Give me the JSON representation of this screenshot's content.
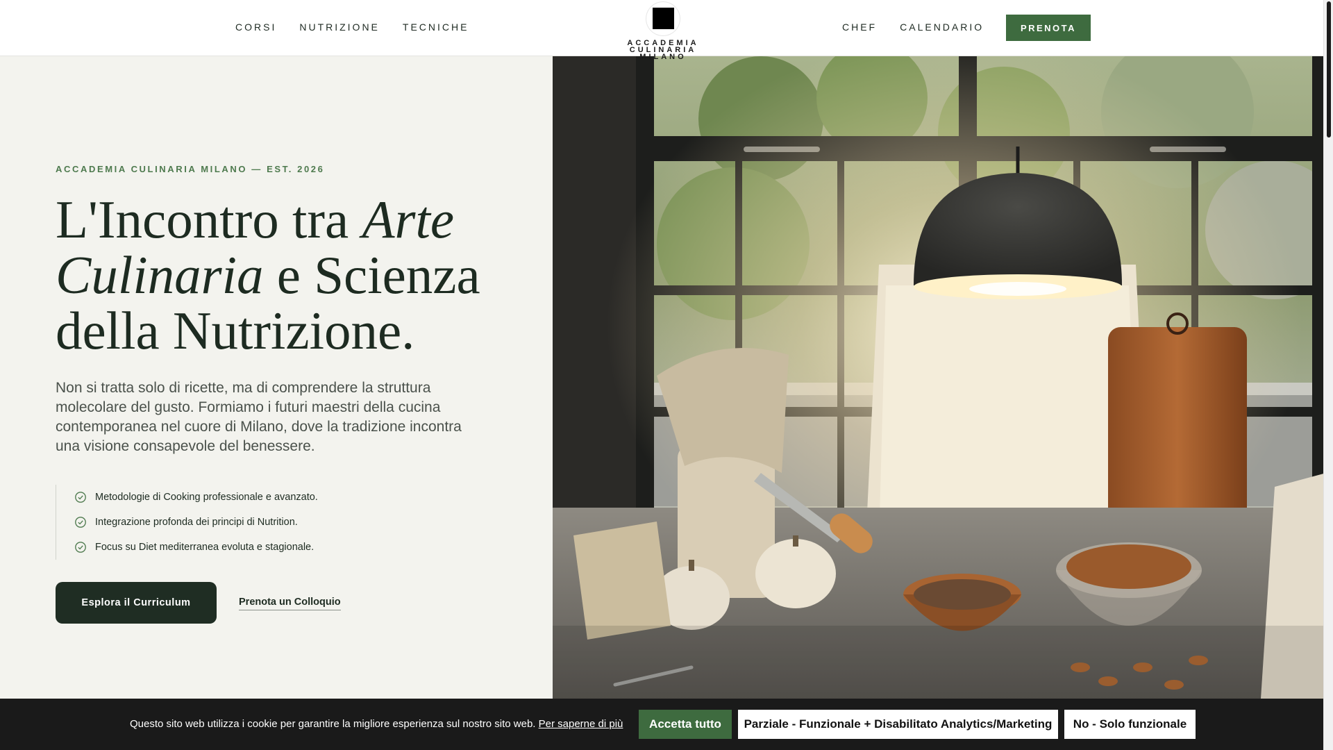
{
  "header": {
    "nav_left": [
      "CORSI",
      "NUTRIZIONE",
      "TECNICHE"
    ],
    "nav_right": [
      "CHEF",
      "CALENDARIO"
    ],
    "brand_line1": "ACCADEMIA CULINARIA",
    "brand_line2": "MILANO",
    "book_label": "PRENOTA"
  },
  "hero": {
    "eyebrow": "ACCADEMIA CULINARIA MILANO — EST. 2026",
    "headline": {
      "part1": "L'Incontro tra ",
      "em1": "Arte Culinaria",
      "part2": " e Scienza della Nutrizione."
    },
    "lead": "Non si tratta solo di ricette, ma di comprendere la struttura molecolare del gusto. Formiamo i futuri maestri della cucina contemporanea nel cuore di Milano, dove la tradizione incontra una visione consapevole del benessere.",
    "features": [
      "Metodologie di Cooking professionale e avanzato.",
      "Integrazione profonda dei principi di Nutrition.",
      "Focus su Diet mediterranea evoluta e stagionale."
    ],
    "primary_cta": "Esplora il Curriculum",
    "secondary_cta": "Prenota un Colloquio"
  },
  "cookie": {
    "text": "Questo sito web utilizza i cookie per garantire la migliore esperienza sul nostro sito web.",
    "link": "Per saperne di più",
    "accept": "Accetta tutto",
    "partial": "Parziale - Funzionale + Disabilitato Analytics/Marketing",
    "deny": "No - Solo funzionale"
  },
  "colors": {
    "accent_green": "#3e6b3f",
    "dark_green": "#1f2d23",
    "hero_bg": "#f3f3ee",
    "cookie_bg": "#1a1a1a"
  },
  "icons": {
    "feature_bullet": "check-circle-icon"
  }
}
